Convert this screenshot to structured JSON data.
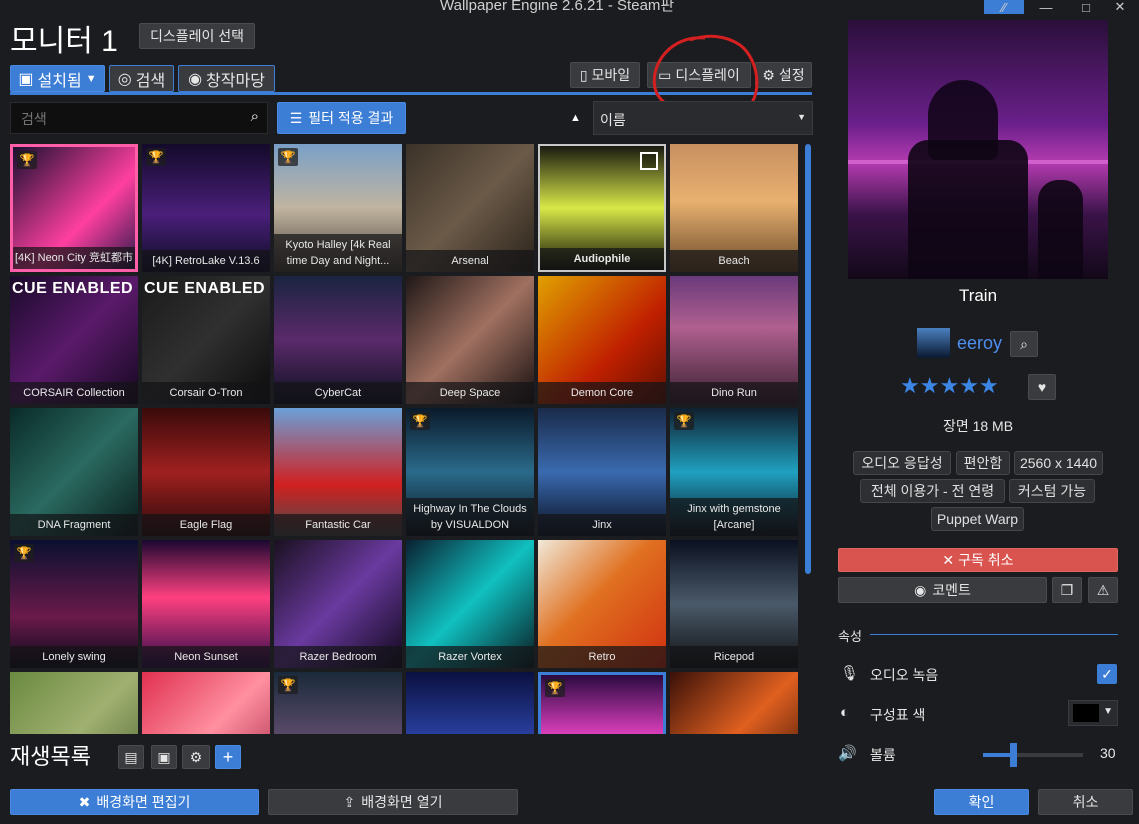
{
  "window": {
    "title": "Wallpaper Engine 2.6.21 - Steam판"
  },
  "header": {
    "monitor_title": "모니터 1",
    "display_select": "디스플레이 선택"
  },
  "tabs": {
    "installed": "설치됨",
    "discover": "검색",
    "workshop": "창작마당"
  },
  "top_right": {
    "mobile": "모바일",
    "display": "디스플레이",
    "settings": "설정"
  },
  "search": {
    "placeholder": "검색",
    "filter_button": "필터 적용 결과",
    "sort_value": "이름"
  },
  "tiles": [
    {
      "label": "[4K] Neon City 竞虹都市",
      "trophy": true
    },
    {
      "label": "[4K] RetroLake V.13.6",
      "trophy": true
    },
    {
      "label": "Kyoto Halley [4k Real time Day and Night...",
      "trophy": true
    },
    {
      "label": "Arsenal"
    },
    {
      "label": "Audiophile",
      "selected_check": true
    },
    {
      "label": "Beach"
    },
    {
      "label": "CORSAIR Collection",
      "cue": "CUE ENABLED"
    },
    {
      "label": "Corsair O-Tron",
      "cue": "CUE ENABLED"
    },
    {
      "label": "CyberCat"
    },
    {
      "label": "Deep Space"
    },
    {
      "label": "Demon Core"
    },
    {
      "label": "Dino Run"
    },
    {
      "label": "DNA Fragment"
    },
    {
      "label": "Eagle Flag"
    },
    {
      "label": "Fantastic Car"
    },
    {
      "label": "Highway In The Clouds by VISUALDON",
      "trophy": true
    },
    {
      "label": "Jinx"
    },
    {
      "label": "Jinx with gemstone [Arcane]",
      "trophy": true
    },
    {
      "label": "Lonely swing",
      "trophy": true
    },
    {
      "label": "Neon Sunset"
    },
    {
      "label": "Razer Bedroom"
    },
    {
      "label": "Razer Vortex"
    },
    {
      "label": "Retro"
    },
    {
      "label": "Ricepod"
    },
    {
      "label": ""
    },
    {
      "label": ""
    },
    {
      "label": "",
      "trophy": true
    },
    {
      "label": ""
    },
    {
      "label": "",
      "trophy": true
    },
    {
      "label": ""
    }
  ],
  "playlist": {
    "title": "재생목록"
  },
  "bottom": {
    "edit": "배경화면 편집기",
    "open": "배경화면 열기",
    "ok": "확인",
    "cancel": "취소"
  },
  "details": {
    "title": "Train",
    "author": "eeroy",
    "rating_stars": 5,
    "meta": "장면 18 MB",
    "tags": [
      "오디오 응답성",
      "편안함",
      "2560 x 1440",
      "전체 이용가 - 전 연령",
      "커스텀 가능",
      "Puppet Warp"
    ],
    "unsubscribe": "구독 취소",
    "comment": "코멘트",
    "properties_title": "속성",
    "audio_recording": "오디오 녹음",
    "scheme_color": "구성표 색",
    "volume_label": "볼륨",
    "volume_value": "30",
    "volume_fraction": 0.3
  },
  "colors": {
    "accent": "#3c7dd6",
    "danger": "#d9534f",
    "star": "#3c86e6"
  }
}
